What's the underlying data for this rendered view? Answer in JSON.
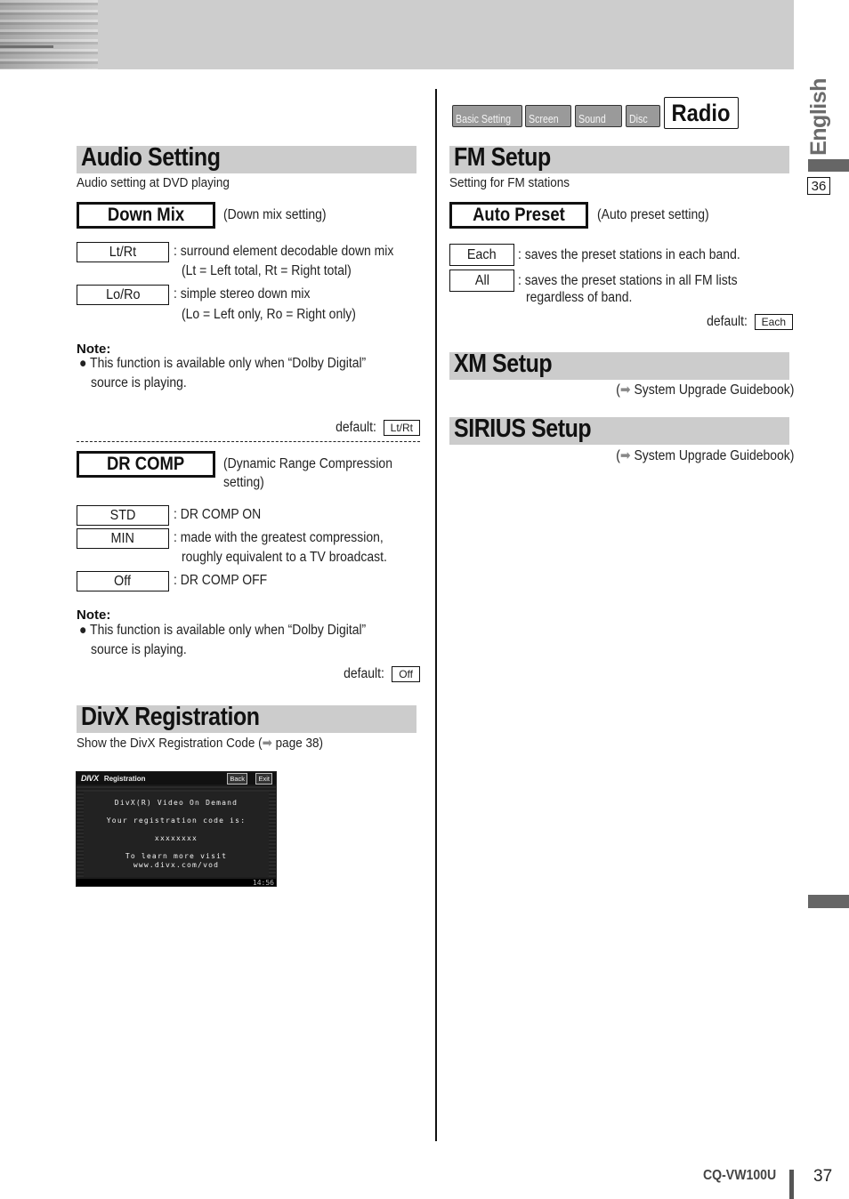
{
  "header": {
    "banner": "decorative photo banner"
  },
  "side": {
    "language": "English",
    "section_page": "36"
  },
  "footer": {
    "model": "CQ-VW100U",
    "page_number": "37"
  },
  "tabs": {
    "items": [
      {
        "label": "Basic Setting"
      },
      {
        "label": "Screen"
      },
      {
        "label": "Sound"
      },
      {
        "label": "Disc"
      }
    ],
    "active": "Radio"
  },
  "audio_setting": {
    "title": "Audio Setting",
    "subtitle": "Audio setting at DVD playing",
    "down_mix": {
      "label": "Down Mix",
      "desc": "(Down mix setting)",
      "options": [
        {
          "value": "Lt/Rt",
          "line1": ": surround element decodable down mix",
          "line2": "(Lt = Left total, Rt = Right total)"
        },
        {
          "value": "Lo/Ro",
          "line1": ": simple stereo down mix",
          "line2": "(Lo = Left only, Ro = Right only)"
        }
      ],
      "note_label": "Note:",
      "note_line1": "This function is available only when “Dolby Digital”",
      "note_line2": "source is playing.",
      "default_label": "default:",
      "default_value": "Lt/Rt"
    },
    "dr_comp": {
      "label": "DR COMP",
      "desc_line1": "(Dynamic Range Compression",
      "desc_line2": "setting)",
      "options": [
        {
          "value": "STD",
          "line1": ": DR COMP ON",
          "line2": ""
        },
        {
          "value": "MIN",
          "line1": ": made with the greatest compression,",
          "line2": "roughly equivalent to a TV broadcast."
        },
        {
          "value": "Off",
          "line1": ": DR COMP OFF",
          "line2": ""
        }
      ],
      "note_label": "Note:",
      "note_line1": "This function is available only when “Dolby Digital”",
      "note_line2": "source is playing.",
      "default_label": "default:",
      "default_value": "Off"
    }
  },
  "divx": {
    "title": "DivX Registration",
    "subtitle_pre": "Show the DivX Registration Code (",
    "arrow": "➡",
    "subtitle_post": " page 38)",
    "screen": {
      "logo": "DIVX",
      "title": "Registration",
      "back": "Back",
      "exit": "Exit",
      "line1": "DivX(R) Video On Demand",
      "line2": "Your registration code is:",
      "code": "xxxxxxxx",
      "line3": "To learn more visit",
      "line4": "www.divx.com/vod",
      "time": "14:56"
    }
  },
  "fm_setup": {
    "title": "FM Setup",
    "subtitle": "Setting for FM stations",
    "auto_preset": {
      "label": "Auto Preset",
      "desc": "(Auto preset setting)",
      "options": [
        {
          "value": "Each",
          "line1": ": saves the preset stations in each band.",
          "line2": ""
        },
        {
          "value": "All",
          "line1": ": saves the preset stations in all FM lists",
          "line2": "regardless of band."
        }
      ],
      "default_label": "default:",
      "default_value": "Each"
    }
  },
  "xm_setup": {
    "title": "XM Setup",
    "ref_arrow": "➡",
    "ref": " System Upgrade Guidebook)",
    "ref_open": "("
  },
  "sirius_setup": {
    "title": "SIRIUS Setup",
    "ref_arrow": "➡",
    "ref": " System Upgrade Guidebook)",
    "ref_open": "("
  }
}
